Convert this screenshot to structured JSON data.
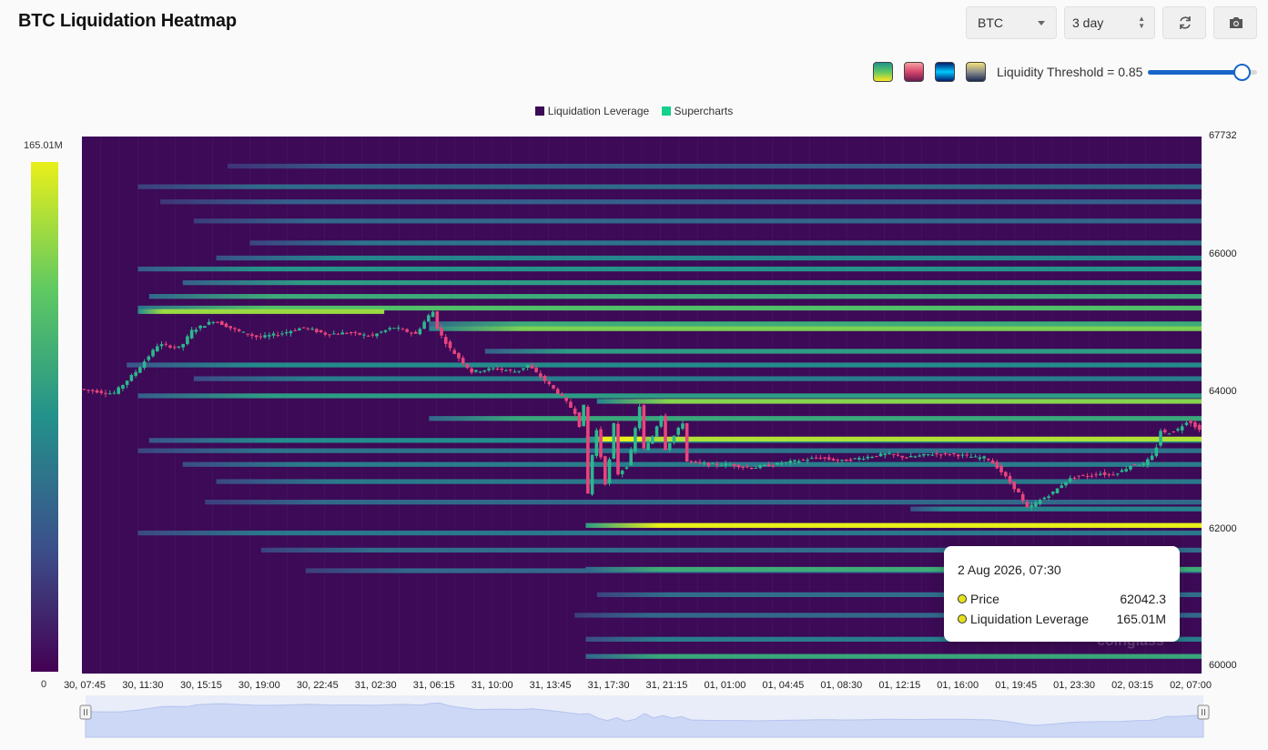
{
  "header": {
    "title": "BTC Liquidation Heatmap",
    "symbol": "BTC",
    "range": "3 day"
  },
  "controls": {
    "threshold_label": "Liquidity Threshold = 0.85",
    "threshold_value": 0.85,
    "refresh_icon": "refresh-icon",
    "camera_icon": "camera-icon"
  },
  "palettes": [
    {
      "name": "viridis",
      "colors": [
        "#21918c",
        "#5ec962",
        "#fde725"
      ]
    },
    {
      "name": "rose",
      "colors": [
        "#f7a1a1",
        "#d6456b",
        "#6a1b4d"
      ]
    },
    {
      "name": "blue-glow",
      "colors": [
        "#001d6e",
        "#00c8ff",
        "#001d6e"
      ]
    },
    {
      "name": "cividis",
      "colors": [
        "#f5e27a",
        "#8b8f8a",
        "#1b2a55"
      ]
    }
  ],
  "colors": {
    "accent": "#1766c8",
    "heat_low": "#440154",
    "heat_mid": "#21918c",
    "heat_high": "#e9ef1a",
    "candle_up": "#2bb88e",
    "candle_down": "#e8457c"
  },
  "chart_data": {
    "type": "heatmap",
    "title": "BTC Liquidation Heatmap",
    "legend": [
      {
        "name": "Liquidation Leverage",
        "color": "#3c0a56"
      },
      {
        "name": "Supercharts",
        "color": "#14d18c"
      }
    ],
    "legend_position": "top-center",
    "colorbar": {
      "max_label": "165.01M",
      "min_label": "0"
    },
    "y_range": [
      59900,
      67732
    ],
    "y_ticks": [
      {
        "value": 67732,
        "label": "67732"
      },
      {
        "value": 66000,
        "label": "66000"
      },
      {
        "value": 64000,
        "label": "64000"
      },
      {
        "value": 62000,
        "label": "62000"
      },
      {
        "value": 60000,
        "label": "60000"
      }
    ],
    "x_ticks": [
      "30, 07:45",
      "30, 11:30",
      "30, 15:15",
      "30, 19:00",
      "30, 22:45",
      "31, 02:30",
      "31, 06:15",
      "31, 10:00",
      "31, 13:45",
      "31, 17:30",
      "31, 21:15",
      "01, 01:00",
      "01, 04:45",
      "01, 08:30",
      "01, 12:15",
      "01, 16:00",
      "01, 19:45",
      "01, 23:30",
      "02, 03:15",
      "02, 07:00"
    ],
    "bands": [
      {
        "price": 67300,
        "start": 0.13,
        "intensity": 0.28
      },
      {
        "price": 67000,
        "start": 0.05,
        "intensity": 0.35
      },
      {
        "price": 66780,
        "start": 0.07,
        "intensity": 0.3
      },
      {
        "price": 66500,
        "start": 0.1,
        "intensity": 0.33
      },
      {
        "price": 66180,
        "start": 0.15,
        "intensity": 0.38
      },
      {
        "price": 65960,
        "start": 0.12,
        "intensity": 0.45
      },
      {
        "price": 65800,
        "start": 0.05,
        "intensity": 0.52
      },
      {
        "price": 65600,
        "start": 0.09,
        "intensity": 0.55
      },
      {
        "price": 65400,
        "start": 0.06,
        "intensity": 0.62
      },
      {
        "price": 65230,
        "start": 0.05,
        "intensity": 0.7
      },
      {
        "price": 65180,
        "start": 0.05,
        "end": 0.27,
        "intensity": 0.86
      },
      {
        "price": 65000,
        "start": 0.31,
        "intensity": 0.62
      },
      {
        "price": 64930,
        "start": 0.31,
        "intensity": 0.8
      },
      {
        "price": 64600,
        "start": 0.36,
        "intensity": 0.55
      },
      {
        "price": 64400,
        "start": 0.04,
        "intensity": 0.48
      },
      {
        "price": 64200,
        "start": 0.1,
        "intensity": 0.42
      },
      {
        "price": 63950,
        "start": 0.05,
        "intensity": 0.55
      },
      {
        "price": 63870,
        "start": 0.46,
        "intensity": 0.82
      },
      {
        "price": 63620,
        "start": 0.31,
        "intensity": 0.6
      },
      {
        "price": 63300,
        "start": 0.06,
        "intensity": 0.48
      },
      {
        "price": 63320,
        "start": 0.45,
        "intensity": 0.9
      },
      {
        "price": 63320,
        "start": 0.46,
        "end": 0.5,
        "intensity": 1.0
      },
      {
        "price": 63150,
        "start": 0.05,
        "intensity": 0.38
      },
      {
        "price": 62950,
        "start": 0.09,
        "intensity": 0.42
      },
      {
        "price": 62700,
        "start": 0.12,
        "intensity": 0.4
      },
      {
        "price": 62400,
        "start": 0.11,
        "intensity": 0.34
      },
      {
        "price": 62300,
        "start": 0.74,
        "intensity": 0.44
      },
      {
        "price": 62060,
        "start": 0.45,
        "intensity": 1.0
      },
      {
        "price": 61950,
        "start": 0.05,
        "intensity": 0.4
      },
      {
        "price": 61700,
        "start": 0.16,
        "intensity": 0.36
      },
      {
        "price": 61400,
        "start": 0.2,
        "intensity": 0.34
      },
      {
        "price": 61420,
        "start": 0.45,
        "intensity": 0.62
      },
      {
        "price": 61050,
        "start": 0.46,
        "intensity": 0.36
      },
      {
        "price": 60750,
        "start": 0.44,
        "intensity": 0.34
      },
      {
        "price": 60400,
        "start": 0.45,
        "intensity": 0.42
      },
      {
        "price": 60150,
        "start": 0.45,
        "intensity": 0.6
      }
    ],
    "price_series": [
      {
        "t": 0.0,
        "p": 64050
      },
      {
        "t": 0.03,
        "p": 63980
      },
      {
        "t": 0.05,
        "p": 64300
      },
      {
        "t": 0.07,
        "p": 64700
      },
      {
        "t": 0.09,
        "p": 64650
      },
      {
        "t": 0.1,
        "p": 64900
      },
      {
        "t": 0.12,
        "p": 65050
      },
      {
        "t": 0.14,
        "p": 64900
      },
      {
        "t": 0.16,
        "p": 64800
      },
      {
        "t": 0.18,
        "p": 64860
      },
      {
        "t": 0.2,
        "p": 64950
      },
      {
        "t": 0.22,
        "p": 64850
      },
      {
        "t": 0.24,
        "p": 64870
      },
      {
        "t": 0.26,
        "p": 64820
      },
      {
        "t": 0.28,
        "p": 64950
      },
      {
        "t": 0.3,
        "p": 64850
      },
      {
        "t": 0.315,
        "p": 65200
      },
      {
        "t": 0.32,
        "p": 64900
      },
      {
        "t": 0.33,
        "p": 64650
      },
      {
        "t": 0.35,
        "p": 64300
      },
      {
        "t": 0.37,
        "p": 64350
      },
      {
        "t": 0.39,
        "p": 64300
      },
      {
        "t": 0.4,
        "p": 64400
      },
      {
        "t": 0.41,
        "p": 64250
      },
      {
        "t": 0.43,
        "p": 63950
      },
      {
        "t": 0.45,
        "p": 63800
      },
      {
        "t": 0.46,
        "p": 63600
      },
      {
        "t": 0.48,
        "p": 63950
      },
      {
        "t": 0.5,
        "p": 63800
      },
      {
        "t": 0.52,
        "p": 63700
      },
      {
        "t": 0.54,
        "p": 63600
      },
      {
        "t": 0.445,
        "p": 63650
      },
      {
        "t": 0.448,
        "p": 63300
      },
      {
        "t": 0.45,
        "p": 62600
      },
      {
        "t": 0.455,
        "p": 62500
      },
      {
        "t": 0.47,
        "p": 62600
      },
      {
        "t": 0.48,
        "p": 62800
      },
      {
        "t": 0.49,
        "p": 62950
      },
      {
        "t": 0.5,
        "p": 63100
      },
      {
        "t": 0.51,
        "p": 63300
      },
      {
        "t": 0.52,
        "p": 63100
      },
      {
        "t": 0.54,
        "p": 63000
      },
      {
        "t": 0.56,
        "p": 62950
      },
      {
        "t": 0.58,
        "p": 62950
      },
      {
        "t": 0.6,
        "p": 62900
      },
      {
        "t": 0.62,
        "p": 62950
      },
      {
        "t": 0.64,
        "p": 63000
      },
      {
        "t": 0.66,
        "p": 63050
      },
      {
        "t": 0.68,
        "p": 63000
      },
      {
        "t": 0.7,
        "p": 63050
      },
      {
        "t": 0.72,
        "p": 63100
      },
      {
        "t": 0.74,
        "p": 63050
      },
      {
        "t": 0.76,
        "p": 63100
      },
      {
        "t": 0.78,
        "p": 63100
      },
      {
        "t": 0.8,
        "p": 63050
      },
      {
        "t": 0.81,
        "p": 63050
      },
      {
        "t": 0.82,
        "p": 62900
      },
      {
        "t": 0.83,
        "p": 62700
      },
      {
        "t": 0.84,
        "p": 62500
      },
      {
        "t": 0.845,
        "p": 62300
      },
      {
        "t": 0.85,
        "p": 62350
      },
      {
        "t": 0.86,
        "p": 62450
      },
      {
        "t": 0.87,
        "p": 62550
      },
      {
        "t": 0.88,
        "p": 62700
      },
      {
        "t": 0.89,
        "p": 62780
      },
      {
        "t": 0.9,
        "p": 62780
      },
      {
        "t": 0.91,
        "p": 62820
      },
      {
        "t": 0.92,
        "p": 62800
      },
      {
        "t": 0.93,
        "p": 62850
      },
      {
        "t": 0.94,
        "p": 62950
      },
      {
        "t": 0.95,
        "p": 62950
      },
      {
        "t": 0.96,
        "p": 63100
      },
      {
        "t": 0.965,
        "p": 63450
      },
      {
        "t": 0.97,
        "p": 63400
      },
      {
        "t": 0.98,
        "p": 63450
      },
      {
        "t": 0.99,
        "p": 63600
      },
      {
        "t": 1.0,
        "p": 63450
      }
    ]
  },
  "tooltip": {
    "title": "2 Aug 2026, 07:30",
    "rows": [
      {
        "label": "Price",
        "value": "62042.3"
      },
      {
        "label": "Liquidation Leverage",
        "value": "165.01M"
      }
    ]
  },
  "navigator": {
    "start": 0.0,
    "end": 1.0
  },
  "watermark": {
    "text": "coinglass"
  }
}
